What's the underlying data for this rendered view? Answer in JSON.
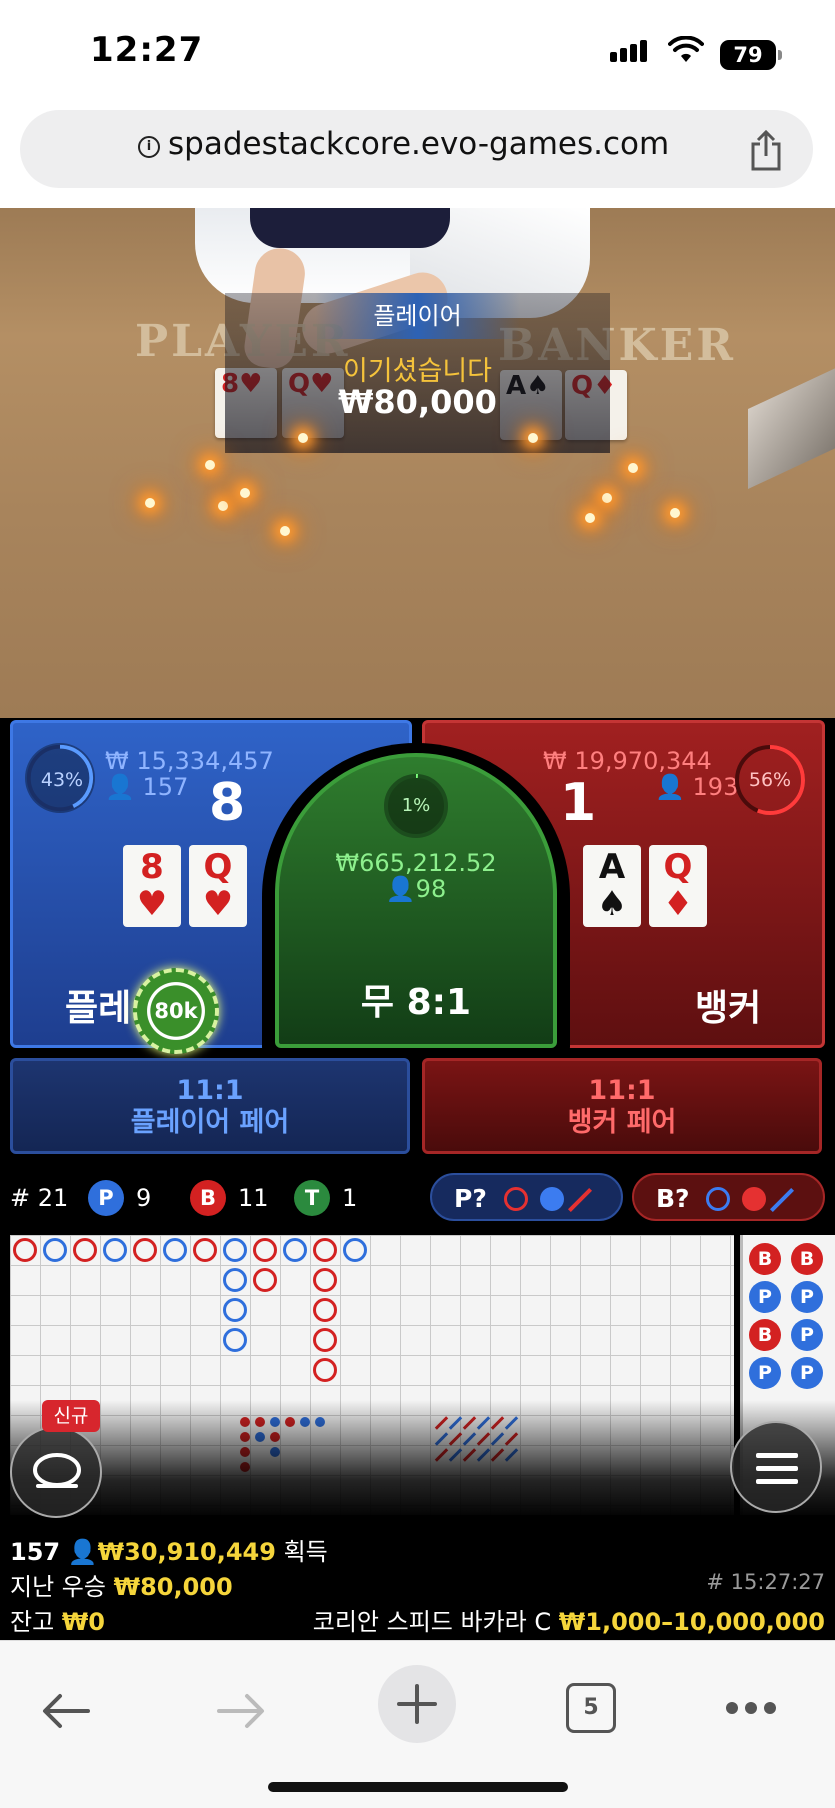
{
  "status": {
    "time": "12:27",
    "battery": "79"
  },
  "browser": {
    "url": "spadestackcore.evo-games.com",
    "tabs_count": "5"
  },
  "table_felt": {
    "player_word": "PLAYER",
    "banker_word": "BANKER"
  },
  "result_banner": {
    "side": "플레이어",
    "title": "이기셨습니다",
    "amount": "₩80,000"
  },
  "player": {
    "percent": "43%",
    "percent_value": 43,
    "total": "₩ 15,334,457",
    "players": "157",
    "score": "8",
    "label": "플레이어",
    "cards": [
      {
        "rank": "8",
        "suit": "♥"
      },
      {
        "rank": "Q",
        "suit": "♥"
      }
    ]
  },
  "banker": {
    "percent": "56%",
    "percent_value": 56,
    "total": "₩ 19,970,344",
    "players": "193",
    "score": "1",
    "label": "뱅커",
    "cards": [
      {
        "rank": "A",
        "suit": "♠"
      },
      {
        "rank": "Q",
        "suit": "♦"
      }
    ]
  },
  "tie": {
    "percent": "1%",
    "percent_value": 1,
    "total": "₩665,212.52",
    "players": "98",
    "label": "무 8:1"
  },
  "chip": {
    "value": "80k"
  },
  "player_pair": {
    "odds": "11:1",
    "label": "플레이어 페어"
  },
  "banker_pair": {
    "odds": "11:1",
    "label": "뱅커 페어"
  },
  "stats": {
    "round": "# 21",
    "p_label": "P",
    "p_count": "9",
    "b_label": "B",
    "b_count": "11",
    "t_label": "T",
    "t_count": "1"
  },
  "predict": {
    "player_label": "P?",
    "banker_label": "B?"
  },
  "side_board": [
    "B",
    "B",
    "P",
    "P",
    "B",
    "P",
    "P",
    "P"
  ],
  "new_tag": "신규",
  "footer": {
    "online_count": "157",
    "total_won": "₩30,910,449",
    "won_label": "획득",
    "last_win_label": "지난 우승",
    "last_win": "₩80,000",
    "game_id": "# 15:27:27",
    "balance_label": "잔고",
    "balance": "₩0",
    "table_name": "코리안 스피드 바카라 C",
    "limits": "₩1,000–10,000,000"
  },
  "colors": {
    "player_blue": "#2f63c8",
    "banker_red": "#a12020",
    "tie_green": "#2f7d2e",
    "gold": "#f5d53b"
  }
}
